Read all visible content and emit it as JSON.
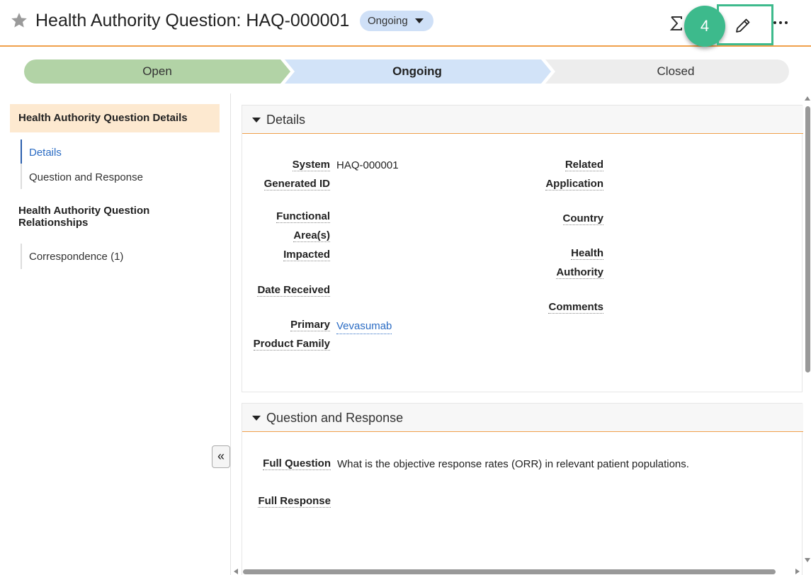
{
  "header": {
    "title": "Health Authority Question: HAQ-000001",
    "state": "Ongoing",
    "step_badge": "4",
    "icons": [
      "star-icon",
      "sigma-icon",
      "pencil-icon",
      "more-icon"
    ]
  },
  "lifecycle": {
    "stages": [
      {
        "label": "Open",
        "color": "#b2d3a6"
      },
      {
        "label": "Ongoing",
        "color": "#d2e3f8"
      },
      {
        "label": "Closed",
        "color": "#ededed"
      }
    ],
    "current": "Ongoing"
  },
  "sidebar": {
    "group1": "Health Authority Question Details",
    "items1": [
      "Details",
      "Question and Response"
    ],
    "group2": "Health Authority Question Relationships",
    "items2": [
      "Correspondence (1)"
    ],
    "collapse_label": "«"
  },
  "details": {
    "heading": "Details",
    "system_id_label": "System Generated ID",
    "system_id_value": "HAQ-000001",
    "functional_label": "Functional Area(s) Impacted",
    "date_label": "Date Received",
    "product_label": "Primary Product Family",
    "product_value": "Vevasumab",
    "related_app_label": "Related Application",
    "country_label": "Country",
    "health_auth_label": "Health Authority",
    "comments_label": "Comments"
  },
  "qa": {
    "heading": "Question and Response",
    "question_label": "Full Question",
    "question_value": "What is the objective response rates (ORR) in relevant patient populations.",
    "response_label": "Full Response"
  },
  "colors": {
    "accent_orange": "#f0a04b",
    "badge_green": "#3dba8c",
    "link_blue": "#2b6cc4",
    "nav_active_bg": "#fde9d0"
  }
}
